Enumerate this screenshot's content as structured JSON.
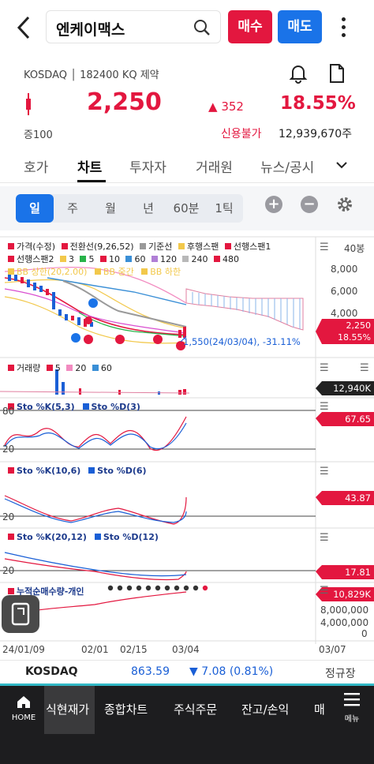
{
  "header": {
    "search_value": "엔케이맥스",
    "buy_label": "매수",
    "sell_label": "매도"
  },
  "stock": {
    "market_info": "KOSDAQ │ 182400 KQ 제약",
    "price": "2,250",
    "change": "352",
    "change_pct": "18.55%",
    "margin_rate": "증100",
    "credit": "신용불가",
    "volume": "12,939,670주"
  },
  "tabs": [
    "호가",
    "차트",
    "투자자",
    "거래원",
    "뉴스/공시"
  ],
  "active_tab": "차트",
  "periods": [
    "일",
    "주",
    "월",
    "년",
    "60분",
    "1틱"
  ],
  "active_period": "일",
  "chart_legend": {
    "row1": [
      "가격(수정)",
      "전환선(9,26,52)",
      "기준선",
      "후행스팬",
      "선행스팬1"
    ],
    "row2": [
      "선행스팬2",
      "3",
      "5",
      "10",
      "60",
      "120",
      "240",
      "480"
    ],
    "row3": [
      "BB 상한(20,2.00)",
      "BB 중간",
      "BB 하한"
    ]
  },
  "price_axis": [
    "40봉",
    "8,000",
    "6,000",
    "4,000"
  ],
  "price_tags": {
    "last_price": "2,250",
    "last_pct": "18.55%",
    "volume_tag": "12,940K",
    "sto1_tag": "67.65",
    "sto2_tag": "43.87",
    "sto3_tag": "17.81",
    "net_buy_tag": "10,829K"
  },
  "low_annotation": "1,550(24/03/04), -31.11%",
  "volume_legend": [
    "거래량",
    "5",
    "20",
    "60"
  ],
  "stochastics": [
    {
      "k": "Sto %K(5,3)",
      "d": "Sto %D(3)"
    },
    {
      "k": "Sto %K(10,6)",
      "d": "Sto %D(6)"
    },
    {
      "k": "Sto %K(20,12)",
      "d": "Sto %D(12)"
    }
  ],
  "sto_levels": [
    "80",
    "20",
    "20",
    "20"
  ],
  "net_buy_title": "누적순매수량-개인",
  "net_buy_axis": [
    "8,000,000",
    "4,000,000",
    "0"
  ],
  "x_dates": [
    "24/01/09",
    "02/01",
    "02/15",
    "03/04",
    "03/07"
  ],
  "ticker": {
    "index_name": "KOSDAQ",
    "index_value": "863.59",
    "index_change": "▼ 7.08 (0.81%)",
    "session": "정규장"
  },
  "bottom_nav": {
    "home": "HOME",
    "items": [
      "식현재가",
      "종합차트",
      "주식주문",
      "잔고/손익",
      "매"
    ],
    "menu": "메뉴"
  },
  "colors": {
    "up_red": "#e3173f",
    "down_blue": "#1a73e8",
    "nav_bg": "#1d1d1f"
  }
}
